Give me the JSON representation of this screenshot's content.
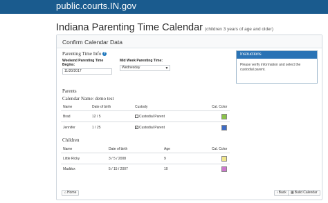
{
  "site": {
    "brand": "public.courts.IN.gov"
  },
  "page": {
    "title": "Indiana Parenting Time Calendar",
    "subtitle": "(children 3 years of age and older)"
  },
  "card": {
    "header": "Confirm Calendar Data"
  },
  "parenting_time": {
    "section_title": "Parenting Time Info",
    "weekend_label": "Weekend Parenting Time Begins:",
    "weekend_value": "11/20/2017",
    "midweek_label": "Mid Week Parenting Time:",
    "midweek_value": "Wednesday"
  },
  "instructions": {
    "title": "Instructions",
    "body": "Please verify information and select the custodial parent."
  },
  "parents": {
    "section_title": "Parents",
    "calendar_name": "Calendar Name: demo test",
    "columns": [
      "Name",
      "Date of birth",
      "Custody",
      "Cal. Color"
    ],
    "rows": [
      {
        "name": "Brad",
        "dob": "12 / 5",
        "custody_label": "Custodial Parent",
        "checked": false,
        "color": "#8bc34a"
      },
      {
        "name": "Jennifer",
        "dob": "1 / 25",
        "custody_label": "Custodial Parent",
        "checked": true,
        "color": "#3f6cc4"
      }
    ]
  },
  "children": {
    "section_title": "Children",
    "columns": [
      "Name",
      "Date of birth",
      "Age",
      "Cal. Color"
    ],
    "rows": [
      {
        "name": "Little Ricky",
        "dob": "3 / 5 / 2008",
        "age": "9",
        "color": "#f0e68c"
      },
      {
        "name": "Maddox",
        "dob": "5 / 15 / 2007",
        "age": "10",
        "color": "#cc77cc"
      }
    ]
  },
  "buttons": {
    "home": "Home",
    "back": "Back",
    "build": "Build Calendar"
  },
  "icons": {
    "info": "info-circle-icon",
    "home": "home-icon",
    "back": "arrow-left-icon",
    "build": "calendar-icon",
    "caret": "chevron-down-icon"
  }
}
